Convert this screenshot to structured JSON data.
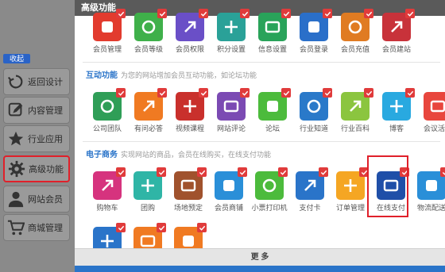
{
  "modal": {
    "title": "高级功能",
    "more_label": "更 多"
  },
  "sidebar": {
    "collapse_label": "收起",
    "items": [
      {
        "label": "返回设计",
        "icon": "back-icon"
      },
      {
        "label": "内容管理",
        "icon": "edit-icon"
      },
      {
        "label": "行业应用",
        "icon": "star-icon"
      },
      {
        "label": "高级功能",
        "icon": "gear-icon",
        "active": true
      },
      {
        "label": "网站会员",
        "icon": "user-icon"
      },
      {
        "label": "商城管理",
        "icon": "cart-icon"
      }
    ]
  },
  "sections": [
    {
      "title": "",
      "desc": "",
      "items": [
        {
          "label": "会员管理",
          "color": "#e23b2e"
        },
        {
          "label": "会员等级",
          "color": "#3fb04a"
        },
        {
          "label": "会员权限",
          "color": "#6a4fc7"
        },
        {
          "label": "积分设置",
          "color": "#2aa198"
        },
        {
          "label": "信息设置",
          "color": "#29a35a"
        },
        {
          "label": "会员登录",
          "color": "#2a6fc9"
        },
        {
          "label": "会员充值",
          "color": "#e07b22"
        },
        {
          "label": "会员建站",
          "color": "#c8323a"
        }
      ]
    },
    {
      "title": "互动功能",
      "desc": "为您的网站增加会员互动功能，如论坛功能",
      "items": [
        {
          "label": "公司团队",
          "color": "#2f9e57"
        },
        {
          "label": "有问必答",
          "color": "#f07a22"
        },
        {
          "label": "视频课程",
          "color": "#c9302c"
        },
        {
          "label": "网站评论",
          "color": "#7b4ab3"
        },
        {
          "label": "论坛",
          "color": "#4cbb3c"
        },
        {
          "label": "行业知道",
          "color": "#2a79c9"
        },
        {
          "label": "行业百科",
          "color": "#8bc53f"
        },
        {
          "label": "博客",
          "color": "#29a9e0"
        },
        {
          "label": "会议活动",
          "color": "#e8463d"
        }
      ]
    },
    {
      "title": "电子商务",
      "desc": "实现网站的商品，会员在线购买，在线支付功能",
      "items": [
        {
          "label": "购物车",
          "color": "#d6337e"
        },
        {
          "label": "团购",
          "color": "#2fb5a6"
        },
        {
          "label": "场地预定",
          "color": "#a0522d"
        },
        {
          "label": "会员商铺",
          "color": "#2a8fd8"
        },
        {
          "label": "小票打印机",
          "color": "#4cbb3c"
        },
        {
          "label": "支付卡",
          "color": "#2a74c9"
        },
        {
          "label": "订单管理",
          "color": "#f5a623"
        },
        {
          "label": "在线支付",
          "color": "#1f4fa8"
        },
        {
          "label": "物流配送",
          "color": "#2a8fd8"
        }
      ]
    },
    {
      "title": "",
      "desc": "",
      "items": [
        {
          "label": "",
          "color": "#2a74c9"
        },
        {
          "label": "",
          "color": "#f07a22"
        },
        {
          "label": "",
          "color": "#f07a22"
        }
      ]
    }
  ]
}
